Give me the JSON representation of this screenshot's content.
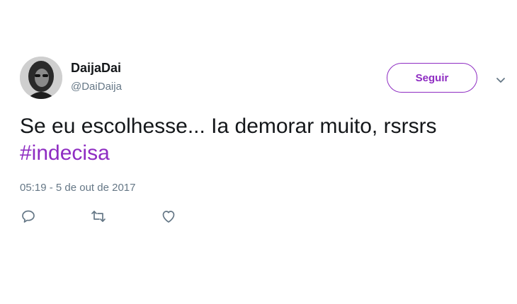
{
  "tweet": {
    "display_name": "DaijaDai",
    "handle": "@DaiDaija",
    "follow_label": "Seguir",
    "text": "Se eu escolhesse... Ia demorar muito, rsrsrs",
    "hashtag": "#indecisa",
    "timestamp": "05:19 - 5 de out de 2017"
  },
  "icons": {
    "avatar": "profile-photo",
    "menu": "chevron-down-icon",
    "reply": "speech-bubble-icon",
    "retweet": "retweet-arrows-icon",
    "like": "heart-icon"
  },
  "colors": {
    "accent": "#8e2cc2",
    "text": "#14171a",
    "secondary": "#657786"
  }
}
